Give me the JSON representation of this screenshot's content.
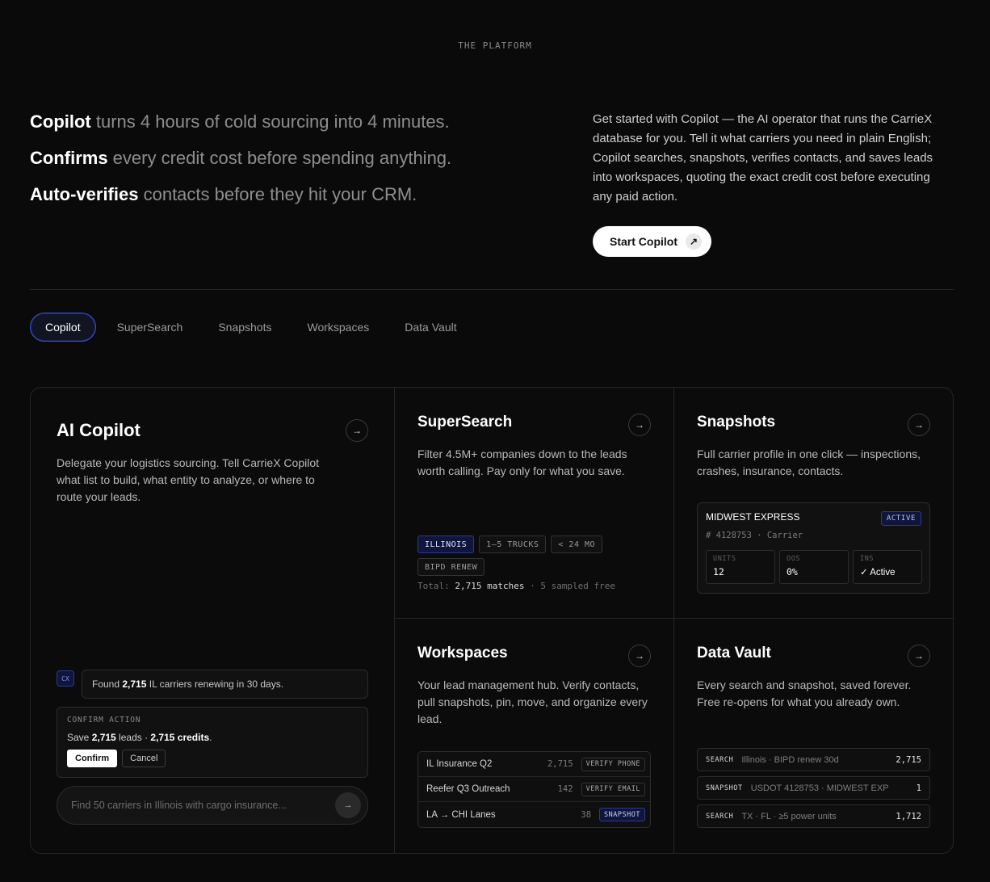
{
  "eyebrow": "THE PLATFORM",
  "hero": {
    "lines": [
      {
        "bold": "Copilot",
        "rest": " turns 4 hours of cold sourcing into 4 minutes."
      },
      {
        "bold": "Confirms",
        "rest": " every credit cost before spending anything."
      },
      {
        "bold": "Auto-verifies",
        "rest": " contacts before they hit your CRM."
      }
    ],
    "description": "Get started with Copilot — the AI operator that runs the CarrieX database for you. Tell it what carriers you need in plain English; Copilot searches, snapshots, verifies contacts, and saves leads into workspaces, quoting the exact credit cost before executing any paid action.",
    "cta_label": "Start Copilot",
    "cta_icon": "arrow-up-right-icon"
  },
  "tabs": [
    {
      "label": "Copilot",
      "active": true
    },
    {
      "label": "SuperSearch",
      "active": false
    },
    {
      "label": "Snapshots",
      "active": false
    },
    {
      "label": "Workspaces",
      "active": false
    },
    {
      "label": "Data Vault",
      "active": false
    }
  ],
  "copilot": {
    "title": "AI Copilot",
    "description": "Delegate your logistics sourcing. Tell CarrieX Copilot what list to build, what entity to analyze, or where to route your leads.",
    "badge": "CX",
    "found_prefix": "Found ",
    "found_count": "2,715",
    "found_suffix": " IL carriers renewing in 30 days.",
    "confirm_label": "CONFIRM ACTION",
    "confirm_prefix": "Save ",
    "confirm_leads": "2,715",
    "confirm_mid": " leads · ",
    "confirm_credits": "2,715 credits",
    "confirm_end": ".",
    "confirm_button": "Confirm",
    "cancel_button": "Cancel",
    "input_placeholder": "Find 50 carriers in Illinois with cargo insurance..."
  },
  "supersearch": {
    "title": "SuperSearch",
    "description": "Filter 4.5M+ companies down to the leads worth calling. Pay only for what you save.",
    "chips": [
      {
        "label": "ILLINOIS",
        "on": true
      },
      {
        "label": "1–5 TRUCKS",
        "on": false
      },
      {
        "label": "< 24 MO",
        "on": false
      },
      {
        "label": "BIPD RENEW",
        "on": false
      }
    ],
    "total_label": "Total: ",
    "total_matches": "2,715 matches",
    "total_suffix": " · 5 sampled free"
  },
  "snapshots": {
    "title": "Snapshots",
    "description": "Full carrier profile in one click — inspections, crashes, insurance, contacts.",
    "carrier_name": "MIDWEST EXPRESS",
    "status": "ACTIVE",
    "subline": "# 4128753 · Carrier",
    "stats": [
      {
        "label": "UNITS",
        "value": "12"
      },
      {
        "label": "OOS",
        "value": "0%"
      },
      {
        "label": "INS",
        "value": "✓ Active"
      }
    ]
  },
  "workspaces": {
    "title": "Workspaces",
    "description": "Your lead management hub. Verify contacts, pull snapshots, pin, move, and organize every lead.",
    "rows": [
      {
        "name": "IL Insurance Q2",
        "count": "2,715",
        "tag": "VERIFY PHONE",
        "blue": false
      },
      {
        "name": "Reefer Q3 Outreach",
        "count": "142",
        "tag": "VERIFY EMAIL",
        "blue": false
      },
      {
        "name": "LA → CHI Lanes",
        "count": "38",
        "tag": "SNAPSHOT",
        "blue": true
      }
    ]
  },
  "vault": {
    "title": "Data Vault",
    "description": "Every search and snapshot, saved forever. Free re-opens for what you already own.",
    "rows": [
      {
        "type": "SEARCH",
        "desc": "Illinois · BIPD renew 30d",
        "count": "2,715"
      },
      {
        "type": "SNAPSHOT",
        "desc": "USDOT 4128753 · MIDWEST EXP",
        "count": "1"
      },
      {
        "type": "SEARCH",
        "desc": "TX · FL · ≥5 power units",
        "count": "1,712"
      }
    ]
  },
  "colors": {
    "accent": "#3a4fd8",
    "background": "#0a0a0a"
  }
}
